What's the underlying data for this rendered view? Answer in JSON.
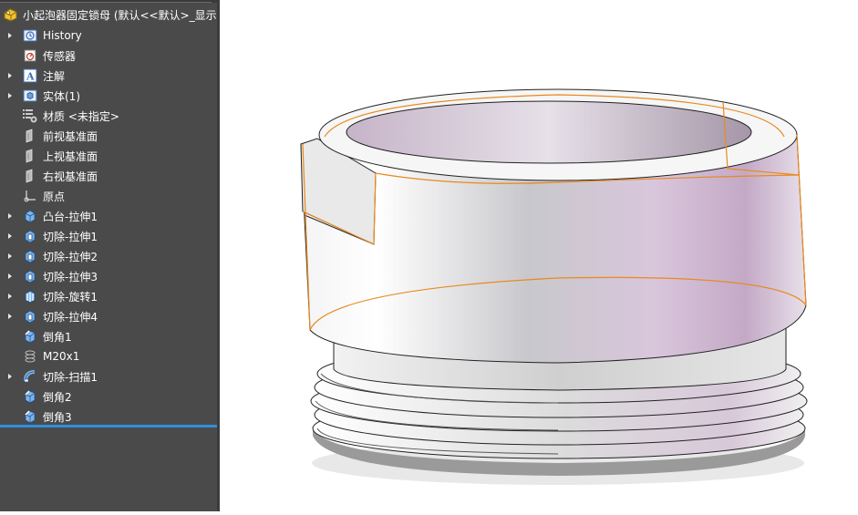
{
  "root": {
    "label": "小起泡器固定锁母 (默认<<默认>_显示",
    "icon": "part-icon"
  },
  "tree_items": [
    {
      "label": "History",
      "icon": "history-icon",
      "expandable": true
    },
    {
      "label": "传感器",
      "icon": "sensor-icon",
      "expandable": false
    },
    {
      "label": "注解",
      "icon": "annotation-icon",
      "expandable": true
    },
    {
      "label": "实体(1)",
      "icon": "solid-bodies-icon",
      "expandable": true
    },
    {
      "label": "材质 <未指定>",
      "icon": "material-icon",
      "expandable": false
    },
    {
      "label": "前视基准面",
      "icon": "plane-icon",
      "expandable": false
    },
    {
      "label": "上视基准面",
      "icon": "plane-icon",
      "expandable": false
    },
    {
      "label": "右视基准面",
      "icon": "plane-icon",
      "expandable": false
    },
    {
      "label": "原点",
      "icon": "origin-icon",
      "expandable": false
    },
    {
      "label": "凸台-拉伸1",
      "icon": "boss-extrude-icon",
      "expandable": true
    },
    {
      "label": "切除-拉伸1",
      "icon": "cut-extrude-icon",
      "expandable": true
    },
    {
      "label": "切除-拉伸2",
      "icon": "cut-extrude-icon",
      "expandable": true
    },
    {
      "label": "切除-拉伸3",
      "icon": "cut-extrude-icon",
      "expandable": true
    },
    {
      "label": "切除-旋转1",
      "icon": "cut-revolve-icon",
      "expandable": true
    },
    {
      "label": "切除-拉伸4",
      "icon": "cut-extrude-icon",
      "expandable": true
    },
    {
      "label": "倒角1",
      "icon": "chamfer-icon",
      "expandable": false
    },
    {
      "label": "M20x1",
      "icon": "cosmetic-thread-icon",
      "expandable": false
    },
    {
      "label": "切除-扫描1",
      "icon": "cut-sweep-icon",
      "expandable": true
    },
    {
      "label": "倒角2",
      "icon": "chamfer-icon",
      "expandable": false
    },
    {
      "label": "倒角3",
      "icon": "chamfer-icon",
      "expandable": false
    }
  ],
  "colors": {
    "panel_bg": "#4a4a4a",
    "rollback_bar": "#2f8fdd",
    "edge_highlight": "#e8891e"
  }
}
